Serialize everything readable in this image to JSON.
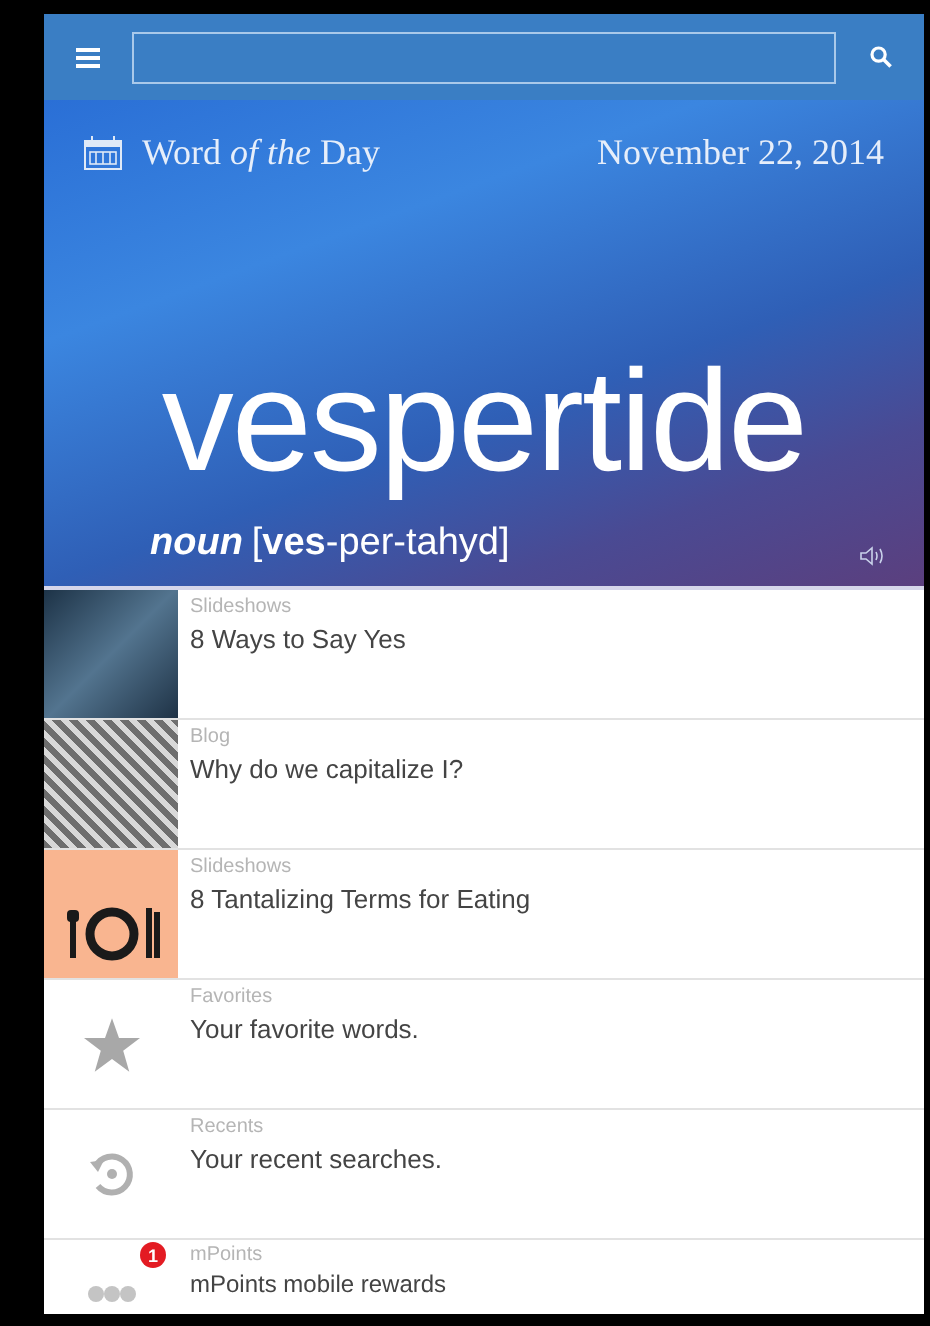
{
  "hero": {
    "title": "Word *of the* Day",
    "date": "November 22, 2014",
    "word": "vespertide",
    "part_of_speech": "noun",
    "pronunciation": "[**ves**-per-tahyd]"
  },
  "items": [
    {
      "kind": "yes-photo",
      "category": "Slideshows",
      "title": "8 Ways to Say Yes"
    },
    {
      "kind": "letter-photo",
      "category": "Blog",
      "title": "Why do we capitalize I?"
    },
    {
      "kind": "dining",
      "category": "Slideshows",
      "title": "8 Tantalizing Terms for Eating"
    },
    {
      "kind": "star",
      "category": "Favorites",
      "title": "Your favorite words."
    },
    {
      "kind": "history",
      "category": "Recents",
      "title": "Your recent searches."
    },
    {
      "kind": "points",
      "category": "mPoints",
      "title": "mPoints mobile rewards",
      "badge": "1"
    }
  ]
}
